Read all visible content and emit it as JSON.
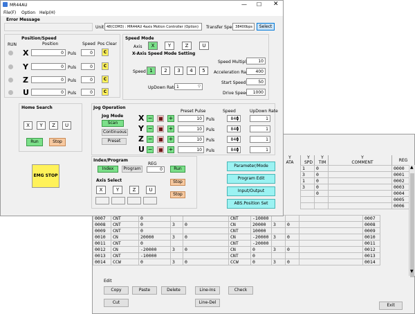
{
  "window": {
    "title": "MR44AU"
  },
  "menu": {
    "items": [
      "File(F)",
      "Option",
      "Help(H)"
    ]
  },
  "error": {
    "label": "Error Message"
  },
  "unit": {
    "label": "Unit",
    "value": "48(COM3) : MR44AU 4axis Motion Controller (Option)",
    "transfer_label": "Transfer Speed",
    "transfer_value": "38400bps",
    "select_label": "Select"
  },
  "position": {
    "title": "Position/Speed",
    "col_run": "RUN",
    "col_position": "Position",
    "col_speed": "Speed",
    "col_clear": "Pos Clear",
    "unit": "Puls",
    "clear_label": "C",
    "axes": [
      {
        "name": "X",
        "position": "0",
        "speed": "0"
      },
      {
        "name": "Y",
        "position": "0",
        "speed": "0"
      },
      {
        "name": "Z",
        "position": "0",
        "speed": "0"
      },
      {
        "name": "U",
        "position": "0",
        "speed": "0"
      }
    ]
  },
  "speed_mode": {
    "title": "Speed Mode",
    "axis_label": "Axis",
    "axes": [
      "X",
      "Y",
      "Z",
      "U"
    ],
    "setting_title": "X-Axis Speed Mode Setting",
    "speed_label": "Speed",
    "speeds": [
      "1",
      "2",
      "3",
      "4",
      "5"
    ],
    "updown_label": "UpDown Rate",
    "updown_value": "1",
    "multiplier_label": "Speed Multiplier",
    "multiplier_value": "10",
    "accel_label": "Acceleration Rate",
    "accel_value": "400",
    "start_label": "Start Speed",
    "start_value": "50",
    "drive_label": "Drive Speed",
    "drive_value": "1000"
  },
  "home": {
    "title": "Home Search",
    "axes": [
      "X",
      "Y",
      "Z",
      "U"
    ],
    "run": "Run",
    "stop": "Stop"
  },
  "jog": {
    "title": "Jog Operation",
    "mode_label": "Jog Mode",
    "modes": [
      "Scan",
      "Continuous",
      "Preset"
    ],
    "col_pulse": "Preset Pulse",
    "col_speed": "Speed",
    "col_updown": "UpDown Rate",
    "minus": "−",
    "plus": "+",
    "unit": "Puls",
    "axes": [
      {
        "name": "X",
        "pulse": "10",
        "speed": "840",
        "updown": "1"
      },
      {
        "name": "Y",
        "pulse": "10",
        "speed": "840",
        "updown": "1"
      },
      {
        "name": "Z",
        "pulse": "10",
        "speed": "840",
        "updown": "1"
      },
      {
        "name": "U",
        "pulse": "10",
        "speed": "840",
        "updown": "1"
      }
    ]
  },
  "index": {
    "title": "Index/Program",
    "index_btn": "Index",
    "program_btn": "Program",
    "reg_label": "REG",
    "reg_value": "0",
    "run": "Run",
    "stop": "Stop",
    "stop2": "Stop",
    "axis_select": "Axis Select",
    "axes": [
      "X",
      "Y",
      "Z",
      "U"
    ]
  },
  "emg": {
    "label": "EMG STOP"
  },
  "side_buttons": [
    "Parameter/Mode",
    "Program Edit",
    "Input/Output",
    "ABS.Position Set"
  ],
  "program": {
    "headers": [
      "",
      "",
      "",
      "",
      "",
      "",
      "Y\nDATA",
      "Y\nSPD",
      "Y\nTIM",
      "Y\nCOMMENT",
      "REG"
    ],
    "top_rows": [
      {
        "spd": "1",
        "tim": "0",
        "reg": "0000"
      },
      {
        "spd": "3",
        "tim": "0",
        "reg": "0001"
      },
      {
        "spd": "1",
        "tim": "0",
        "reg": "0002"
      },
      {
        "spd": "3",
        "tim": "0",
        "reg": "0003"
      },
      {
        "spd": "",
        "tim": "0",
        "reg": "0004"
      },
      {
        "spd": "",
        "tim": "",
        "reg": "0005"
      },
      {
        "spd": "",
        "tim": "",
        "reg": "0006"
      }
    ],
    "rows": [
      {
        "no": "0007",
        "cmd": "CNT",
        "a": "0",
        "b": "",
        "c": "",
        "ycmd": "CNT",
        "ydata": "-10000",
        "spd": "",
        "tim": "",
        "reg": "0007"
      },
      {
        "no": "0008",
        "cmd": "CNT",
        "a": "0",
        "b": "3",
        "c": "0",
        "ycmd": "CN",
        "ydata": "20000",
        "spd": "3",
        "tim": "0",
        "reg": "0008"
      },
      {
        "no": "0009",
        "cmd": "CNT",
        "a": "0",
        "b": "",
        "c": "",
        "ycmd": "CNT",
        "ydata": "10000",
        "spd": "",
        "tim": "",
        "reg": "0009"
      },
      {
        "no": "0010",
        "cmd": "CN",
        "a": "20000",
        "b": "3",
        "c": "0",
        "ycmd": "CN",
        "ydata": "-20000",
        "spd": "3",
        "tim": "0",
        "reg": "0010"
      },
      {
        "no": "0011",
        "cmd": "CNT",
        "a": "0",
        "b": "",
        "c": "",
        "ycmd": "CNT",
        "ydata": "-20000",
        "spd": "",
        "tim": "",
        "reg": "0011"
      },
      {
        "no": "0012",
        "cmd": "CN",
        "a": "-20000",
        "b": "3",
        "c": "0",
        "ycmd": "CN",
        "ydata": "0",
        "spd": "3",
        "tim": "0",
        "reg": "0012"
      },
      {
        "no": "0013",
        "cmd": "CNT",
        "a": "-10000",
        "b": "",
        "c": "",
        "ycmd": "CNT",
        "ydata": "0",
        "spd": "",
        "tim": "",
        "reg": "0013"
      },
      {
        "no": "0014",
        "cmd": "CCW",
        "a": "0",
        "b": "3",
        "c": "0",
        "ycmd": "CCW",
        "ydata": "0",
        "spd": "3",
        "tim": "0",
        "reg": "0014"
      }
    ],
    "edit_label": "Edit",
    "buttons": [
      "Copy",
      "Paste",
      "Delete",
      "Line-Ins",
      "Check",
      "Cut",
      "Line-Del"
    ],
    "exit": "Exit"
  }
}
